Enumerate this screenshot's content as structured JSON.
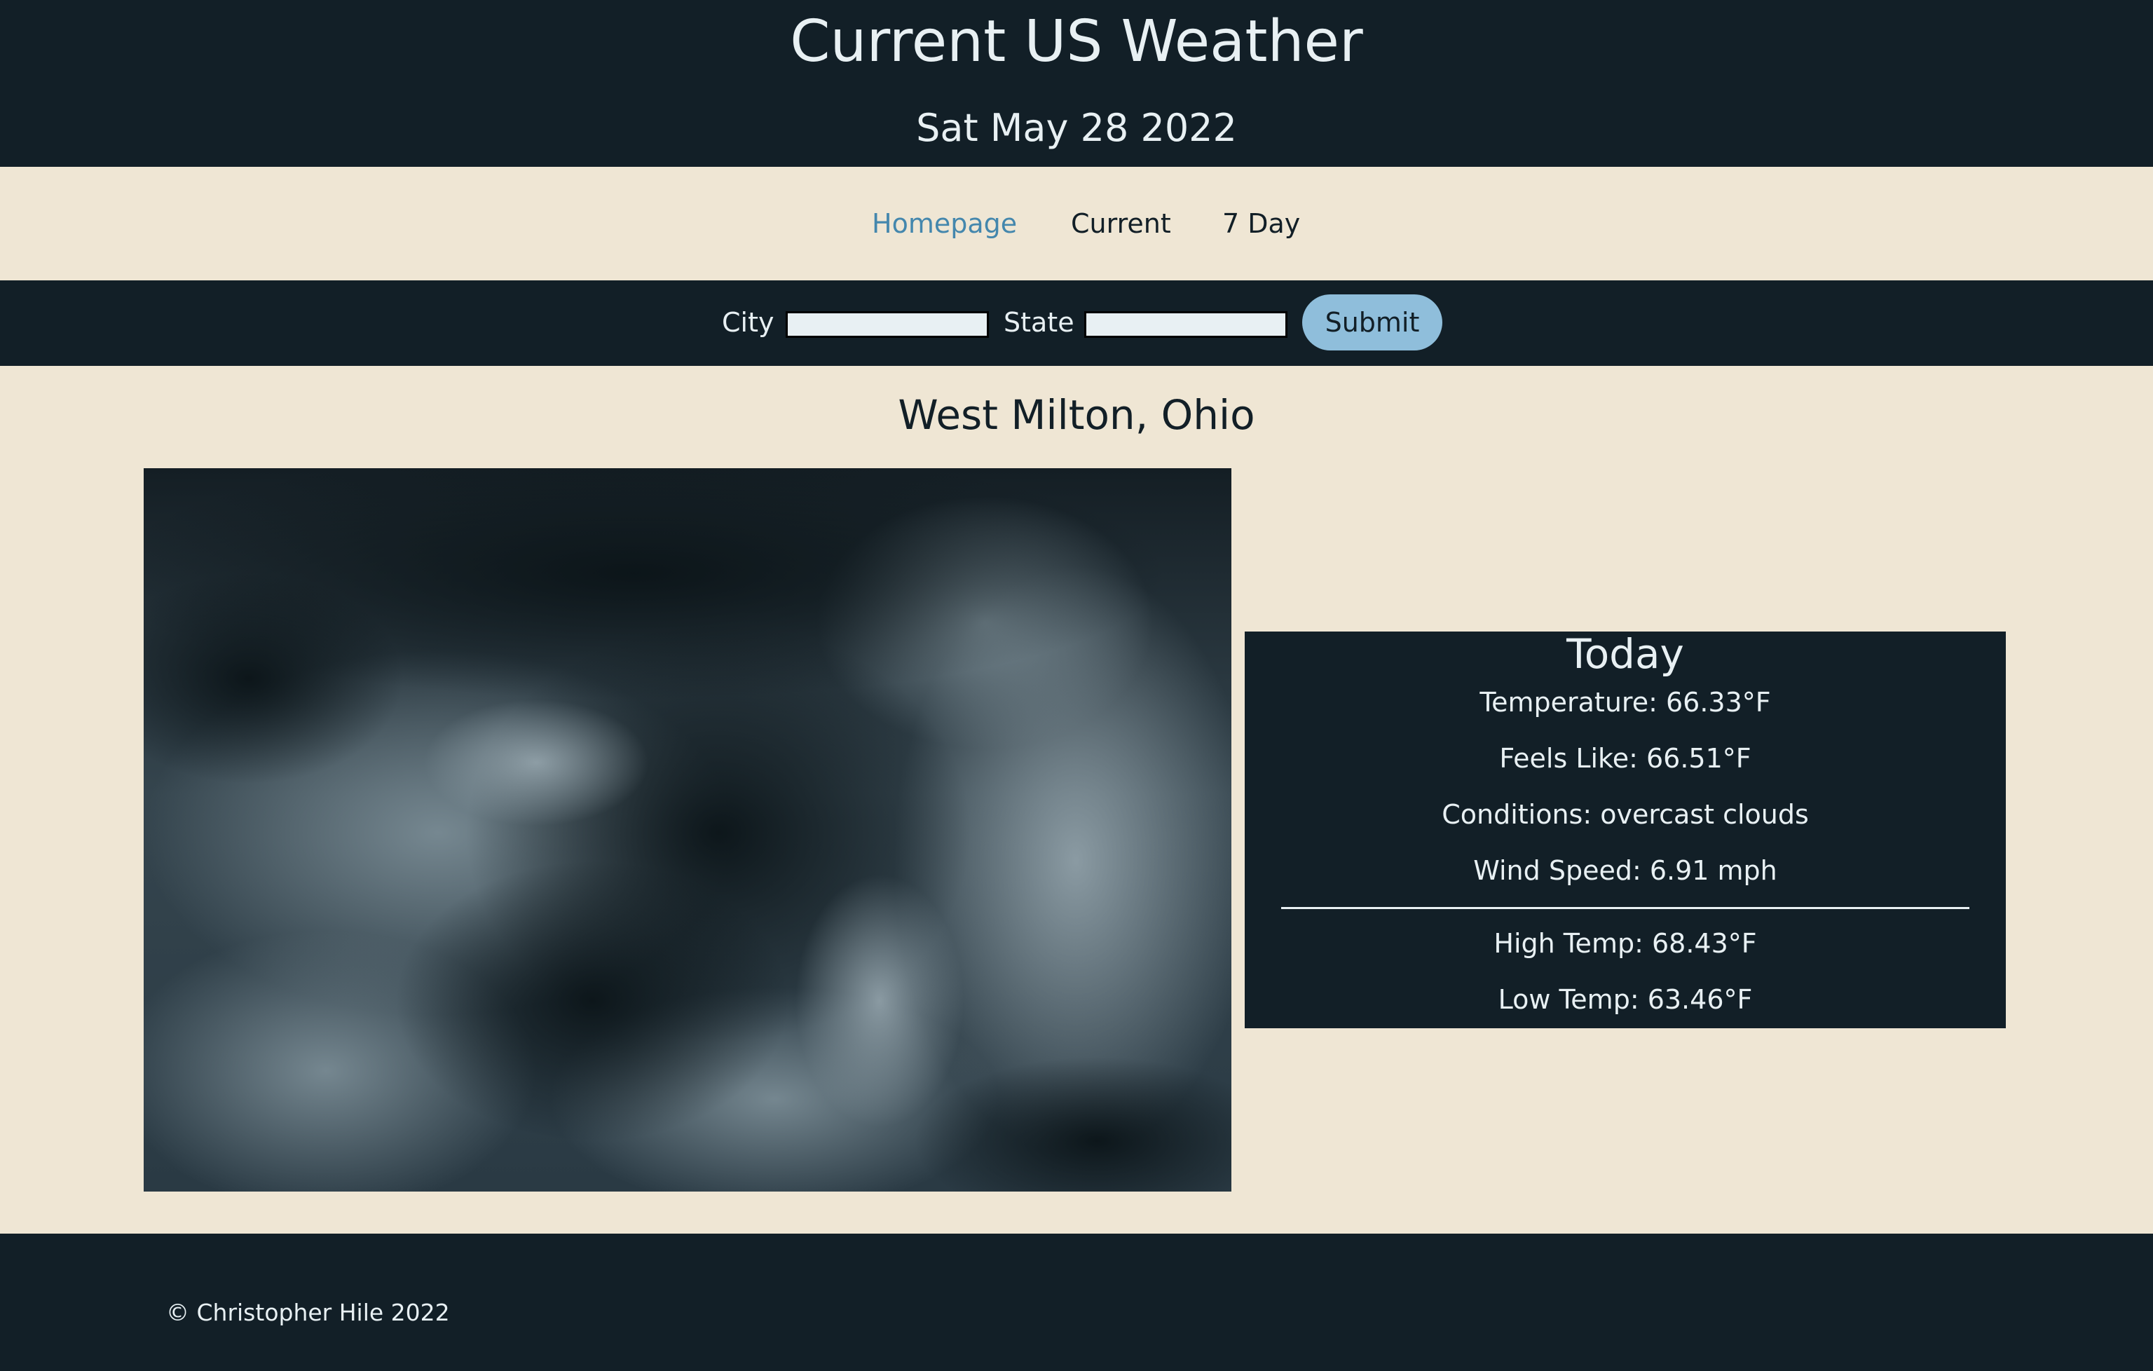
{
  "header": {
    "title": "Current US Weather",
    "date": "Sat May 28 2022"
  },
  "nav": {
    "items": [
      {
        "label": "Homepage",
        "active": true
      },
      {
        "label": "Current",
        "active": false
      },
      {
        "label": "7 Day",
        "active": false
      }
    ]
  },
  "search": {
    "city_label": "City",
    "city_value": "",
    "state_label": "State",
    "state_value": "",
    "submit_label": "Submit"
  },
  "location": "West Milton, Ohio",
  "image": {
    "subject": "dark storm clouds"
  },
  "today": {
    "title": "Today",
    "temperature": "Temperature: 66.33°F",
    "feels_like": "Feels Like: 66.51°F",
    "conditions": "Conditions: overcast clouds",
    "wind_speed": "Wind Speed: 6.91 mph",
    "high_temp": "High Temp: 68.43°F",
    "low_temp": "Low Temp: 63.46°F"
  },
  "footer": {
    "copyright": "© Christopher Hile 2022"
  },
  "colors": {
    "dark": "#121f27",
    "cream": "#efe6d4",
    "accent_link": "#4487ad",
    "button": "#8fbedb"
  }
}
